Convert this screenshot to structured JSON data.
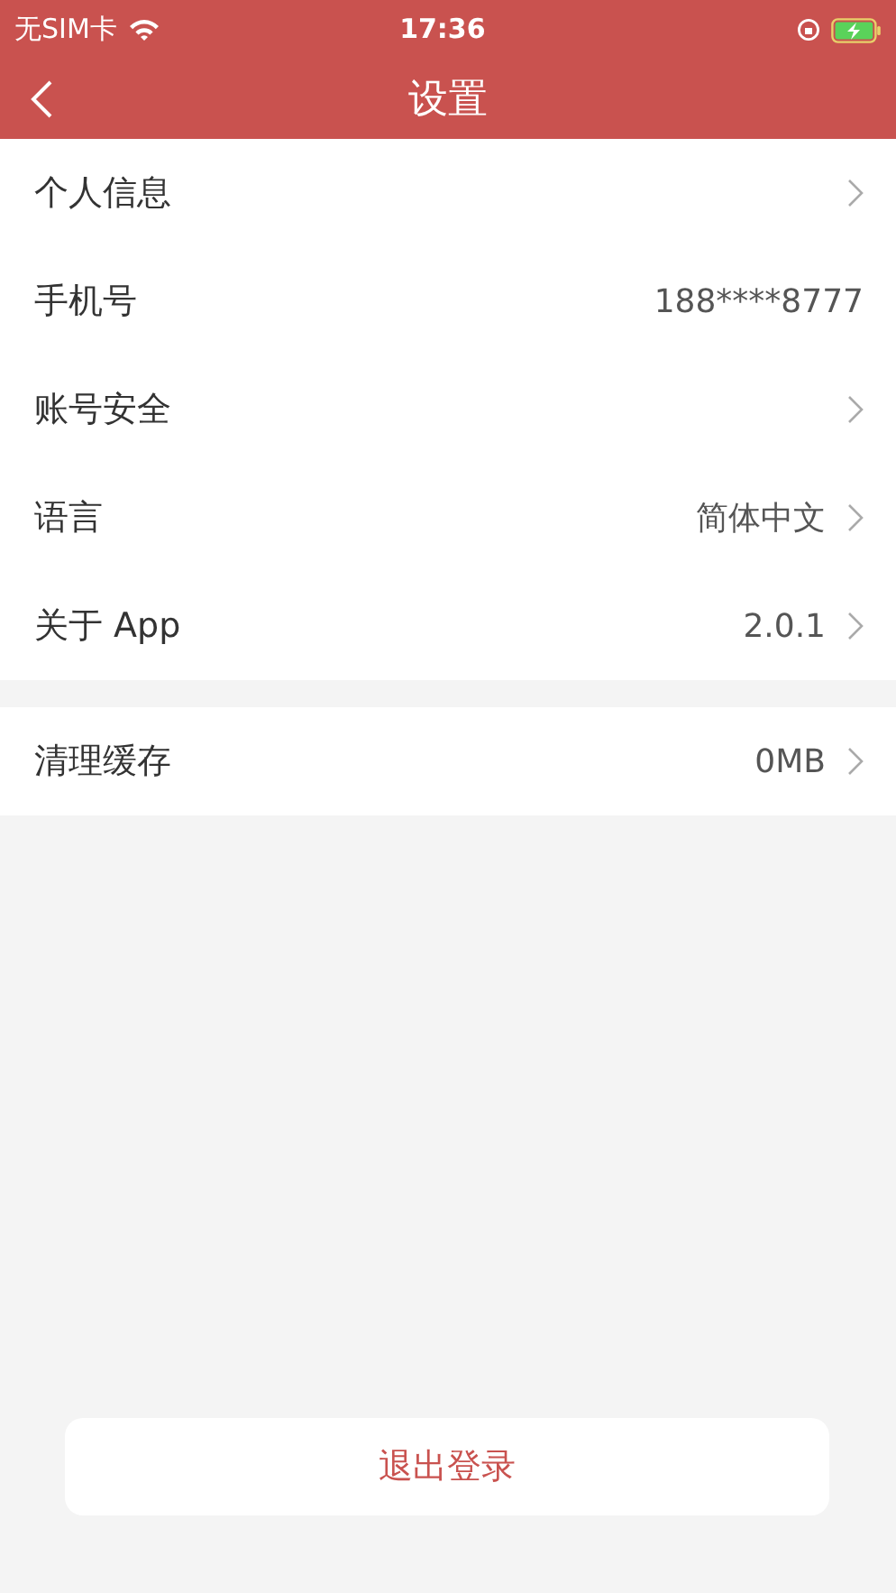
{
  "status_bar": {
    "carrier": "无SIM卡",
    "time": "17:36"
  },
  "nav_bar": {
    "title": "设置"
  },
  "groups": [
    {
      "rows": [
        {
          "label": "个人信息",
          "chevron": true
        },
        {
          "label": "手机号",
          "value": "188****8777",
          "chevron": false
        },
        {
          "label": "账号安全",
          "chevron": true
        },
        {
          "label": "语言",
          "value": "简体中文",
          "chevron": true
        },
        {
          "label": "关于 App",
          "value": "2.0.1",
          "chevron": true
        }
      ]
    },
    {
      "rows": [
        {
          "label": "清理缓存",
          "value": "0MB",
          "chevron": true
        }
      ]
    }
  ],
  "logout_button": {
    "label": "退出登录"
  }
}
